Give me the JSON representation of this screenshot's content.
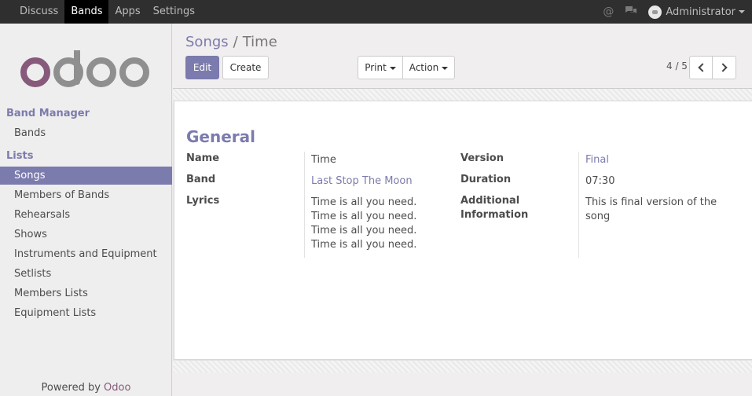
{
  "topbar": {
    "menu": [
      "Discuss",
      "Bands",
      "Apps",
      "Settings"
    ],
    "active_index": 1,
    "at_icon": "@",
    "chat_icon": "chat-bubbles-icon",
    "user_name": "Administrator"
  },
  "sidebar": {
    "logo_text": "odoo",
    "section1_title": "Band Manager",
    "section1_items": [
      "Bands"
    ],
    "section2_title": "Lists",
    "section2_items": [
      "Songs",
      "Members of Bands",
      "Rehearsals",
      "Shows",
      "Instruments and Equipment",
      "Setlists",
      "Members Lists",
      "Equipment Lists"
    ],
    "active_item": "Songs",
    "powered_prefix": "Powered by",
    "powered_brand": "Odoo"
  },
  "control": {
    "breadcrumb_parent": "Songs",
    "breadcrumb_sep": "/",
    "breadcrumb_current": "Time",
    "edit_label": "Edit",
    "create_label": "Create",
    "print_label": "Print",
    "action_label": "Action",
    "pager": "4 / 5"
  },
  "form": {
    "group_title": "General",
    "name_label": "Name",
    "name_value": "Time",
    "band_label": "Band",
    "band_value": "Last Stop The Moon",
    "lyrics_label": "Lyrics",
    "lyrics_lines": [
      "Time is all you need.",
      "Time is all you need.",
      "Time is all you need.",
      "Time is all you need."
    ],
    "version_label": "Version",
    "version_value": "Final",
    "duration_label": "Duration",
    "duration_value": "07:30",
    "addinfo_label_1": "Additional",
    "addinfo_label_2": "Information",
    "addinfo_line_1": "This is final version of the",
    "addinfo_line_2": "song"
  },
  "colors": {
    "accent": "#7c7bad",
    "brand": "#875a7b",
    "topbar": "#2f2f2f"
  }
}
